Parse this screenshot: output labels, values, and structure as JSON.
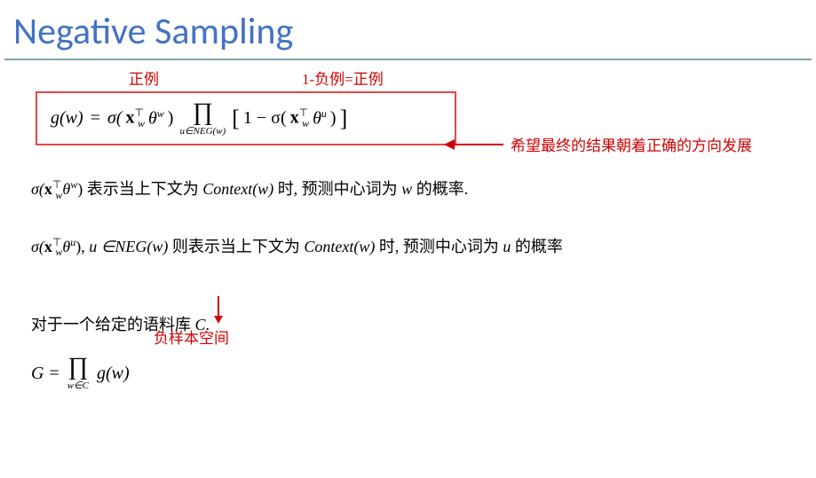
{
  "title": "Negative Sampling",
  "annotations": {
    "positive": "正例",
    "one_minus_neg": "1-负例=正例",
    "hope_text": "希望最终的结果朝着正确的方向发展",
    "neg_sample_space": "负样本空间"
  },
  "formula1": {
    "lhs": "g(w)",
    "eq": "=",
    "sigma1_pre": "σ(",
    "x": "x",
    "x_sub": "w",
    "x_sup": "⊤",
    "theta": "θ",
    "theta_sup_w": "w",
    "close": ")",
    "prod": "∏",
    "prod_sub": "u∈NEG(w)",
    "bracket_open": "[",
    "one_minus": "1 − σ(",
    "theta_sup_u": "u",
    "bracket_close": "]"
  },
  "text1": {
    "sigma_expr": "σ(",
    "sigma_close": ")",
    "desc1": " 表示当上下文为 ",
    "context": "Context(w)",
    "desc2": " 时, 预测中心词为 ",
    "w": "w",
    "desc3": " 的概率."
  },
  "text2": {
    "comma_u": ", ",
    "u_in_neg": "u ∈NEG(w)",
    "desc1": " 则表示当上下文为 ",
    "context": "Context(w)",
    "desc2": " 时, 预测中心词为 ",
    "u": "u",
    "desc3": " 的概率"
  },
  "text3": {
    "for_corpus": "对于一个给定的语料库 ",
    "C": "C",
    "period": "."
  },
  "formula2": {
    "G": "G",
    "eq": "=",
    "prod": "∏",
    "prod_sub": "w∈C",
    "gw": "g(w)"
  }
}
